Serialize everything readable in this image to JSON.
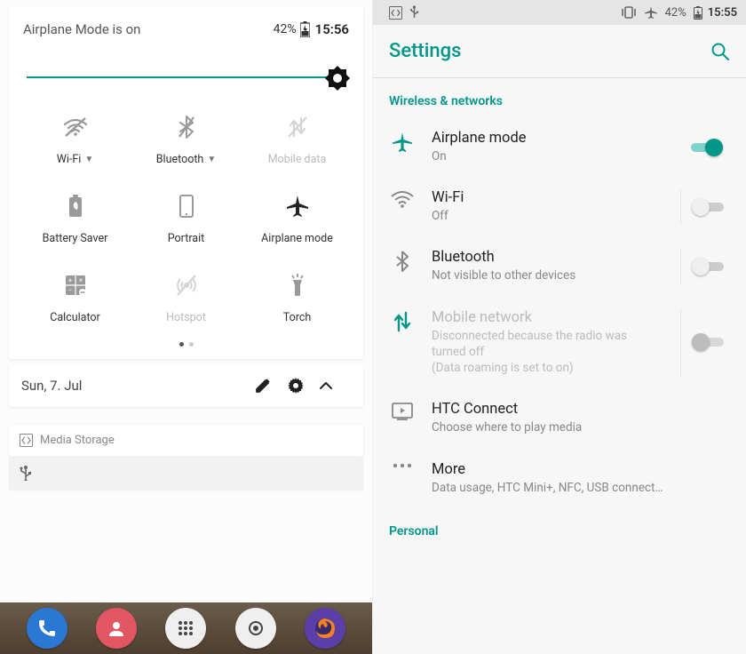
{
  "left": {
    "status": {
      "title": "Airplane Mode is on",
      "battery_pct": "42%",
      "time": "15:56"
    },
    "tiles": [
      {
        "id": "wifi",
        "label": "Wi-Fi",
        "style": "off",
        "dropdown": true
      },
      {
        "id": "bt",
        "label": "Bluetooth",
        "style": "off",
        "dropdown": true
      },
      {
        "id": "data",
        "label": "Mobile data",
        "style": "dim",
        "dropdown": false
      },
      {
        "id": "battsaver",
        "label": "Battery Saver",
        "style": "off",
        "dropdown": false
      },
      {
        "id": "portrait",
        "label": "Portrait",
        "style": "off",
        "dropdown": false
      },
      {
        "id": "airplane",
        "label": "Airplane mode",
        "style": "active",
        "dropdown": false
      },
      {
        "id": "calc",
        "label": "Calculator",
        "style": "off",
        "dropdown": false
      },
      {
        "id": "hotspot",
        "label": "Hotspot",
        "style": "dim",
        "dropdown": false
      },
      {
        "id": "torch",
        "label": "Torch",
        "style": "off",
        "dropdown": false
      }
    ],
    "footer": {
      "date": "Sun, 7. Jul"
    },
    "notification": {
      "app": "Media Storage"
    }
  },
  "right": {
    "statusbar": {
      "battery_pct": "42%",
      "time": "15:55"
    },
    "appbar_title": "Settings",
    "section_wireless": "Wireless & networks",
    "rows": {
      "airplane": {
        "title": "Airplane mode",
        "sub": "On"
      },
      "wifi": {
        "title": "Wi-Fi",
        "sub": "Off"
      },
      "bt": {
        "title": "Bluetooth",
        "sub": "Not visible to other devices"
      },
      "mobile": {
        "title": "Mobile network",
        "sub": "Disconnected because the radio was turned off\n(Data roaming is set to on)"
      },
      "htcconnect": {
        "title": "HTC Connect",
        "sub": "Choose where to play media"
      },
      "more": {
        "title": "More",
        "sub": "Data usage, HTC Mini+, NFC, USB connect…"
      }
    },
    "section_personal": "Personal"
  }
}
